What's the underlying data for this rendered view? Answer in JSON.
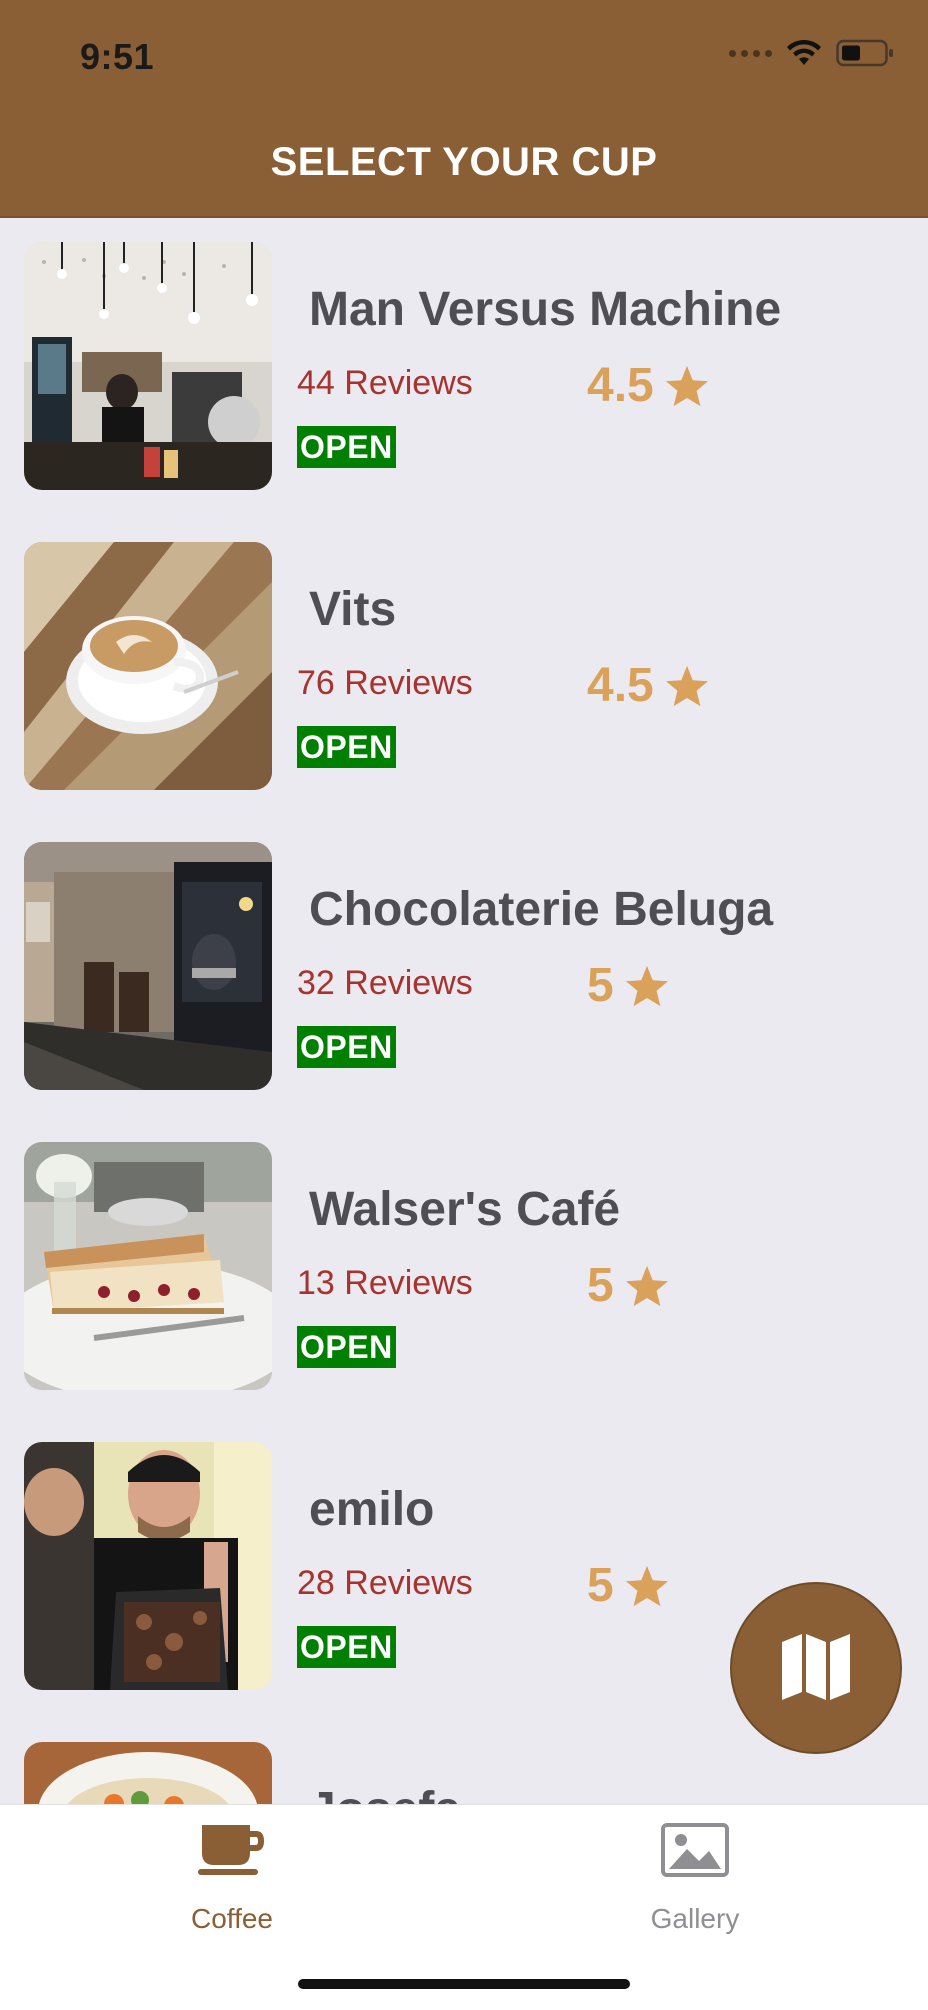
{
  "status_bar": {
    "time": "9:51"
  },
  "header": {
    "title": "SELECT YOUR CUP"
  },
  "shops": [
    {
      "name": "Man Versus Machine",
      "reviews": "44 Reviews",
      "rating": "4.5",
      "status": "OPEN"
    },
    {
      "name": "Vits",
      "reviews": "76 Reviews",
      "rating": "4.5",
      "status": "OPEN"
    },
    {
      "name": "Chocolaterie Beluga",
      "reviews": "32 Reviews",
      "rating": "5",
      "status": "OPEN"
    },
    {
      "name": "Walser's Café",
      "reviews": "13 Reviews",
      "rating": "5",
      "status": "OPEN"
    },
    {
      "name": "emilo",
      "reviews": "28 Reviews",
      "rating": "5",
      "status": "OPEN"
    },
    {
      "name": "Josefa",
      "reviews": "",
      "rating": "",
      "status": ""
    }
  ],
  "fab": {
    "icon": "map-icon"
  },
  "tabbar": {
    "tabs": [
      {
        "label": "Coffee",
        "icon": "coffee-cup-icon",
        "active": true
      },
      {
        "label": "Gallery",
        "icon": "gallery-icon",
        "active": false
      }
    ]
  },
  "colors": {
    "header_bg": "#8a5f35",
    "list_bg": "#ebeaf1",
    "name_text": "#4e4e54",
    "reviews_text": "#a8322e",
    "rating_text": "#d9a15a",
    "open_badge": "#008000",
    "tab_active": "#8a5f35",
    "tab_inactive": "#8e8e93"
  }
}
